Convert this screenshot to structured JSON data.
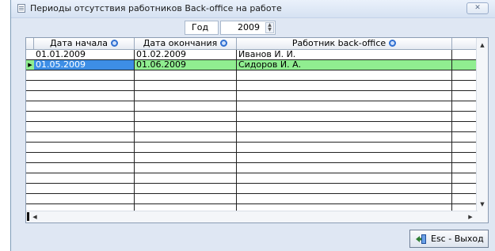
{
  "window": {
    "title": "Периоды отсутствия работников Back-office на работе",
    "close_icon": "close-icon"
  },
  "filter": {
    "year_label": "Год",
    "year_value": "2009"
  },
  "table": {
    "columns": [
      "Дата начала",
      "Дата окончания",
      "Работник back-office"
    ],
    "rows": [
      {
        "start": "01.01.2009",
        "end": "01.02.2009",
        "employee": "Иванов И. И."
      },
      {
        "start": "01.05.2009",
        "end": "01.06.2009",
        "employee": "Сидоров И. А."
      }
    ],
    "selected_row": 1,
    "selected_color": "#90ee90",
    "selected_cell_color": "#3d8ee6"
  },
  "footer": {
    "exit_label": "Esc - Выход",
    "exit_icon": "exit-door-icon"
  }
}
